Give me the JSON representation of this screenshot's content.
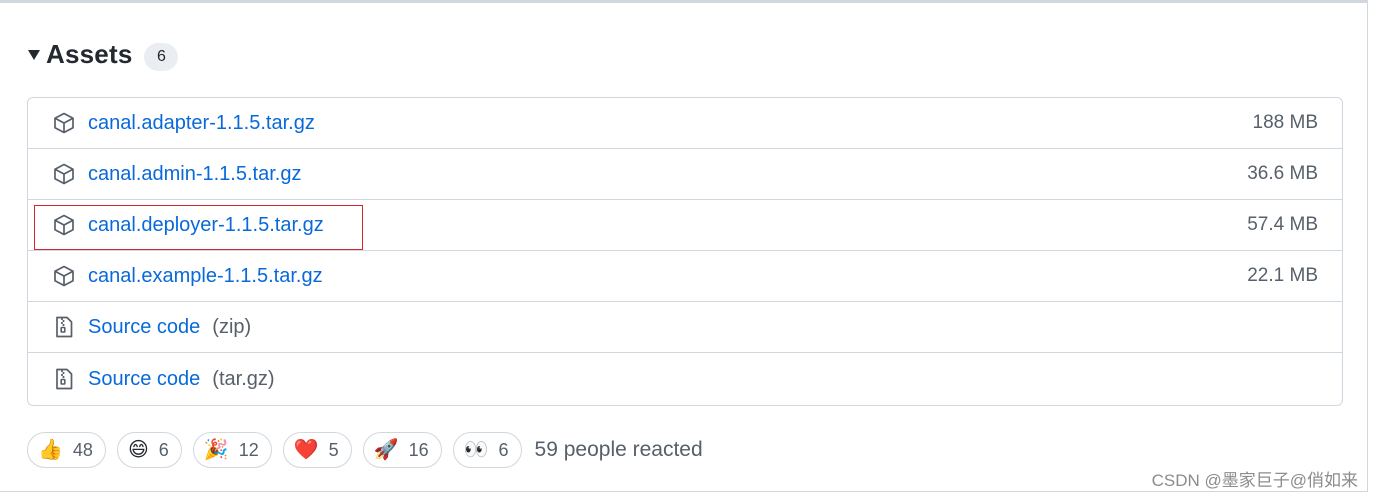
{
  "assets": {
    "title": "Assets",
    "count": "6",
    "items": [
      {
        "name": "canal.adapter-1.1.5.tar.gz",
        "size": "188 MB",
        "icon": "package-icon"
      },
      {
        "name": "canal.admin-1.1.5.tar.gz",
        "size": "36.6 MB",
        "icon": "package-icon"
      },
      {
        "name": "canal.deployer-1.1.5.tar.gz",
        "size": "57.4 MB",
        "icon": "package-icon",
        "highlighted": true
      },
      {
        "name": "canal.example-1.1.5.tar.gz",
        "size": "22.1 MB",
        "icon": "package-icon"
      },
      {
        "name": "Source code",
        "ext": "(zip)",
        "icon": "file-zip-icon"
      },
      {
        "name": "Source code",
        "ext": "(tar.gz)",
        "icon": "file-zip-icon"
      }
    ]
  },
  "reactions": {
    "items": [
      {
        "emoji": "👍",
        "icon": "thumbs-up-icon",
        "count": "48"
      },
      {
        "emoji": "😄",
        "icon": "laugh-icon",
        "count": "6"
      },
      {
        "emoji": "🎉",
        "icon": "hooray-icon",
        "count": "12"
      },
      {
        "emoji": "❤️",
        "icon": "heart-icon",
        "count": "5"
      },
      {
        "emoji": "🚀",
        "icon": "rocket-icon",
        "count": "16"
      },
      {
        "emoji": "👀",
        "icon": "eyes-icon",
        "count": "6"
      }
    ],
    "summary": "59 people reacted"
  },
  "watermark": "CSDN @墨家巨子@俏如来",
  "colors": {
    "link": "#0969da",
    "muted": "#57606a",
    "border": "#d0d7de",
    "highlight": "#d6262b"
  }
}
